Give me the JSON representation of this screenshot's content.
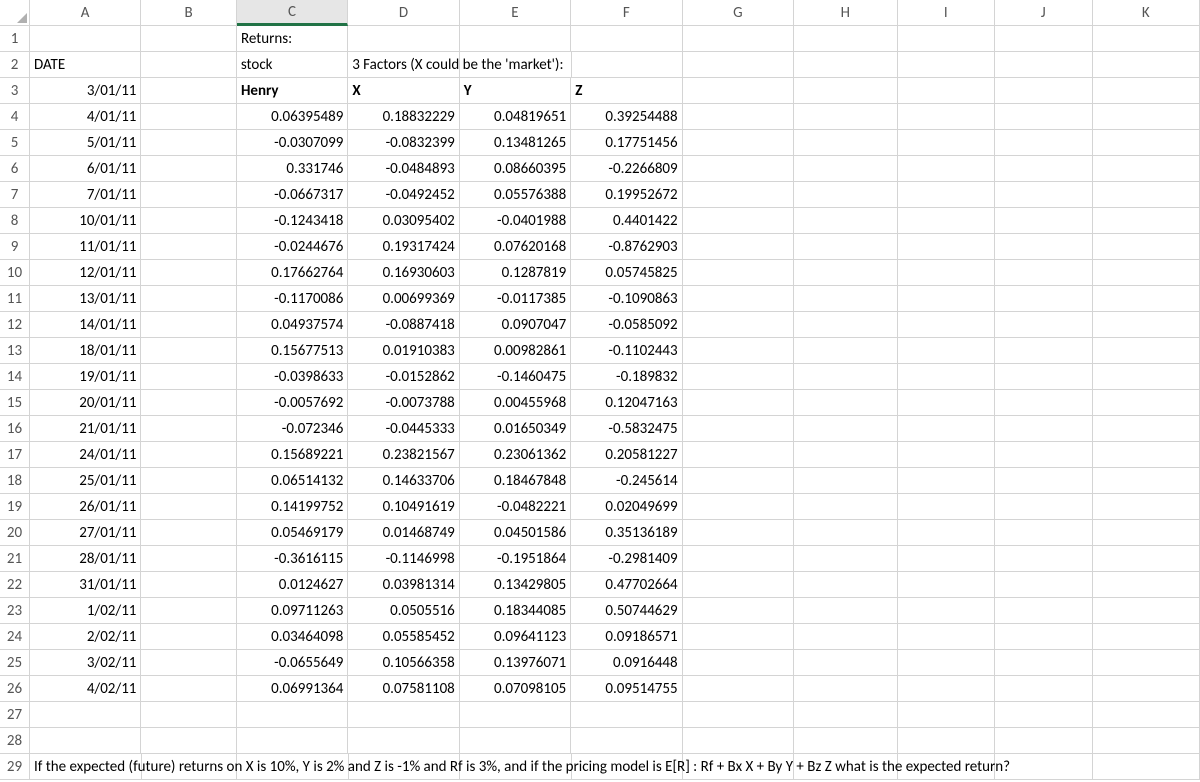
{
  "columns": [
    "A",
    "B",
    "C",
    "D",
    "E",
    "F",
    "G",
    "H",
    "I",
    "J",
    "K"
  ],
  "selected_column": "C",
  "rows": [
    {
      "n": 1,
      "C": {
        "v": "Returns:",
        "cls": "text"
      }
    },
    {
      "n": 2,
      "A": {
        "v": "DATE",
        "cls": "text"
      },
      "C": {
        "v": "stock",
        "cls": "text"
      },
      "D": {
        "v": "3 Factors (X could be the 'market'):",
        "cls": "text overflow"
      }
    },
    {
      "n": 3,
      "A": {
        "v": "3/01/11",
        "cls": "num"
      },
      "C": {
        "v": "Henry",
        "cls": "text bold"
      },
      "D": {
        "v": "X",
        "cls": "text bold"
      },
      "E": {
        "v": "Y",
        "cls": "text bold"
      },
      "F": {
        "v": "Z",
        "cls": "text bold"
      }
    },
    {
      "n": 4,
      "A": {
        "v": "4/01/11",
        "cls": "num"
      },
      "C": {
        "v": "0.06395489",
        "cls": "num"
      },
      "D": {
        "v": "0.18832229",
        "cls": "num"
      },
      "E": {
        "v": "0.04819651",
        "cls": "num"
      },
      "F": {
        "v": "0.39254488",
        "cls": "num"
      }
    },
    {
      "n": 5,
      "A": {
        "v": "5/01/11",
        "cls": "num"
      },
      "C": {
        "v": "-0.0307099",
        "cls": "num"
      },
      "D": {
        "v": "-0.0832399",
        "cls": "num"
      },
      "E": {
        "v": "0.13481265",
        "cls": "num"
      },
      "F": {
        "v": "0.17751456",
        "cls": "num"
      }
    },
    {
      "n": 6,
      "A": {
        "v": "6/01/11",
        "cls": "num"
      },
      "C": {
        "v": "0.331746",
        "cls": "num"
      },
      "D": {
        "v": "-0.0484893",
        "cls": "num"
      },
      "E": {
        "v": "0.08660395",
        "cls": "num"
      },
      "F": {
        "v": "-0.2266809",
        "cls": "num"
      }
    },
    {
      "n": 7,
      "A": {
        "v": "7/01/11",
        "cls": "num"
      },
      "C": {
        "v": "-0.0667317",
        "cls": "num"
      },
      "D": {
        "v": "-0.0492452",
        "cls": "num"
      },
      "E": {
        "v": "0.05576388",
        "cls": "num"
      },
      "F": {
        "v": "0.19952672",
        "cls": "num"
      }
    },
    {
      "n": 8,
      "A": {
        "v": "10/01/11",
        "cls": "num"
      },
      "C": {
        "v": "-0.1243418",
        "cls": "num"
      },
      "D": {
        "v": "0.03095402",
        "cls": "num"
      },
      "E": {
        "v": "-0.0401988",
        "cls": "num"
      },
      "F": {
        "v": "0.4401422",
        "cls": "num"
      }
    },
    {
      "n": 9,
      "A": {
        "v": "11/01/11",
        "cls": "num"
      },
      "C": {
        "v": "-0.0244676",
        "cls": "num"
      },
      "D": {
        "v": "0.19317424",
        "cls": "num"
      },
      "E": {
        "v": "0.07620168",
        "cls": "num"
      },
      "F": {
        "v": "-0.8762903",
        "cls": "num"
      }
    },
    {
      "n": 10,
      "A": {
        "v": "12/01/11",
        "cls": "num"
      },
      "C": {
        "v": "0.17662764",
        "cls": "num"
      },
      "D": {
        "v": "0.16930603",
        "cls": "num"
      },
      "E": {
        "v": "0.1287819",
        "cls": "num"
      },
      "F": {
        "v": "0.05745825",
        "cls": "num"
      }
    },
    {
      "n": 11,
      "A": {
        "v": "13/01/11",
        "cls": "num"
      },
      "C": {
        "v": "-0.1170086",
        "cls": "num"
      },
      "D": {
        "v": "0.00699369",
        "cls": "num"
      },
      "E": {
        "v": "-0.0117385",
        "cls": "num"
      },
      "F": {
        "v": "-0.1090863",
        "cls": "num"
      }
    },
    {
      "n": 12,
      "A": {
        "v": "14/01/11",
        "cls": "num"
      },
      "C": {
        "v": "0.04937574",
        "cls": "num"
      },
      "D": {
        "v": "-0.0887418",
        "cls": "num"
      },
      "E": {
        "v": "0.0907047",
        "cls": "num"
      },
      "F": {
        "v": "-0.0585092",
        "cls": "num"
      }
    },
    {
      "n": 13,
      "A": {
        "v": "18/01/11",
        "cls": "num"
      },
      "C": {
        "v": "0.15677513",
        "cls": "num"
      },
      "D": {
        "v": "0.01910383",
        "cls": "num"
      },
      "E": {
        "v": "0.00982861",
        "cls": "num"
      },
      "F": {
        "v": "-0.1102443",
        "cls": "num"
      }
    },
    {
      "n": 14,
      "A": {
        "v": "19/01/11",
        "cls": "num"
      },
      "C": {
        "v": "-0.0398633",
        "cls": "num"
      },
      "D": {
        "v": "-0.0152862",
        "cls": "num"
      },
      "E": {
        "v": "-0.1460475",
        "cls": "num"
      },
      "F": {
        "v": "-0.189832",
        "cls": "num"
      }
    },
    {
      "n": 15,
      "A": {
        "v": "20/01/11",
        "cls": "num"
      },
      "C": {
        "v": "-0.0057692",
        "cls": "num"
      },
      "D": {
        "v": "-0.0073788",
        "cls": "num"
      },
      "E": {
        "v": "0.00455968",
        "cls": "num"
      },
      "F": {
        "v": "0.12047163",
        "cls": "num"
      }
    },
    {
      "n": 16,
      "A": {
        "v": "21/01/11",
        "cls": "num"
      },
      "C": {
        "v": "-0.072346",
        "cls": "num"
      },
      "D": {
        "v": "-0.0445333",
        "cls": "num"
      },
      "E": {
        "v": "0.01650349",
        "cls": "num"
      },
      "F": {
        "v": "-0.5832475",
        "cls": "num"
      }
    },
    {
      "n": 17,
      "A": {
        "v": "24/01/11",
        "cls": "num"
      },
      "C": {
        "v": "0.15689221",
        "cls": "num"
      },
      "D": {
        "v": "0.23821567",
        "cls": "num"
      },
      "E": {
        "v": "0.23061362",
        "cls": "num"
      },
      "F": {
        "v": "0.20581227",
        "cls": "num"
      }
    },
    {
      "n": 18,
      "A": {
        "v": "25/01/11",
        "cls": "num"
      },
      "C": {
        "v": "0.06514132",
        "cls": "num"
      },
      "D": {
        "v": "0.14633706",
        "cls": "num"
      },
      "E": {
        "v": "0.18467848",
        "cls": "num"
      },
      "F": {
        "v": "-0.245614",
        "cls": "num"
      }
    },
    {
      "n": 19,
      "A": {
        "v": "26/01/11",
        "cls": "num"
      },
      "C": {
        "v": "0.14199752",
        "cls": "num"
      },
      "D": {
        "v": "0.10491619",
        "cls": "num"
      },
      "E": {
        "v": "-0.0482221",
        "cls": "num"
      },
      "F": {
        "v": "0.02049699",
        "cls": "num"
      }
    },
    {
      "n": 20,
      "A": {
        "v": "27/01/11",
        "cls": "num"
      },
      "C": {
        "v": "0.05469179",
        "cls": "num"
      },
      "D": {
        "v": "0.01468749",
        "cls": "num"
      },
      "E": {
        "v": "0.04501586",
        "cls": "num"
      },
      "F": {
        "v": "0.35136189",
        "cls": "num"
      }
    },
    {
      "n": 21,
      "A": {
        "v": "28/01/11",
        "cls": "num"
      },
      "C": {
        "v": "-0.3616115",
        "cls": "num"
      },
      "D": {
        "v": "-0.1146998",
        "cls": "num"
      },
      "E": {
        "v": "-0.1951864",
        "cls": "num"
      },
      "F": {
        "v": "-0.2981409",
        "cls": "num"
      }
    },
    {
      "n": 22,
      "A": {
        "v": "31/01/11",
        "cls": "num"
      },
      "C": {
        "v": "0.0124627",
        "cls": "num"
      },
      "D": {
        "v": "0.03981314",
        "cls": "num"
      },
      "E": {
        "v": "0.13429805",
        "cls": "num"
      },
      "F": {
        "v": "0.47702664",
        "cls": "num"
      }
    },
    {
      "n": 23,
      "A": {
        "v": "1/02/11",
        "cls": "num"
      },
      "C": {
        "v": "0.09711263",
        "cls": "num"
      },
      "D": {
        "v": "0.0505516",
        "cls": "num"
      },
      "E": {
        "v": "0.18344085",
        "cls": "num"
      },
      "F": {
        "v": "0.50744629",
        "cls": "num"
      }
    },
    {
      "n": 24,
      "A": {
        "v": "2/02/11",
        "cls": "num"
      },
      "C": {
        "v": "0.03464098",
        "cls": "num"
      },
      "D": {
        "v": "0.05585452",
        "cls": "num"
      },
      "E": {
        "v": "0.09641123",
        "cls": "num"
      },
      "F": {
        "v": "0.09186571",
        "cls": "num"
      }
    },
    {
      "n": 25,
      "A": {
        "v": "3/02/11",
        "cls": "num"
      },
      "C": {
        "v": "-0.0655649",
        "cls": "num"
      },
      "D": {
        "v": "0.10566358",
        "cls": "num"
      },
      "E": {
        "v": "0.13976071",
        "cls": "num"
      },
      "F": {
        "v": "0.0916448",
        "cls": "num"
      }
    },
    {
      "n": 26,
      "A": {
        "v": "4/02/11",
        "cls": "num"
      },
      "C": {
        "v": "0.06991364",
        "cls": "num"
      },
      "D": {
        "v": "0.07581108",
        "cls": "num"
      },
      "E": {
        "v": "0.07098105",
        "cls": "num"
      },
      "F": {
        "v": "0.09514755",
        "cls": "num"
      }
    },
    {
      "n": 27
    },
    {
      "n": 28
    },
    {
      "n": 29,
      "A": {
        "v": "If the expected (future) returns on X is 10%, Y is 2% and Z is -1% and Rf is 3%, and if the pricing model is E[R] : Rf + Bx X + By Y + Bz Z what is the expected return?",
        "cls": "text overflow"
      }
    }
  ]
}
